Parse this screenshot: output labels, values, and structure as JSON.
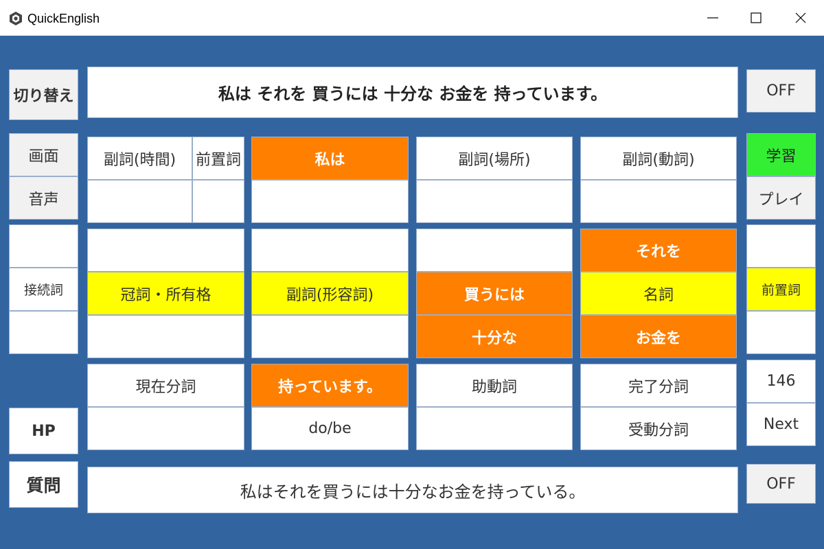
{
  "window": {
    "title": "QuickEnglish"
  },
  "left": {
    "switch": "切り替え",
    "screen": "画面",
    "voice": "音声",
    "conjunction": "接続詞",
    "hp": "HP",
    "question": "質問"
  },
  "right": {
    "off_top": "OFF",
    "study": "学習",
    "play": "プレイ",
    "preposition": "前置詞",
    "count": "146",
    "next": "Next",
    "off_bottom": "OFF"
  },
  "sentence": "私は それを 買うには 十分な お金を 持っています。",
  "translation": "私はそれを買うには十分なお金を持っている。",
  "grid": {
    "adverb_time": "副詞(時間)",
    "preposition": "前置詞",
    "subject": "私は",
    "adverb_place": "副詞(場所)",
    "adverb_verb": "副詞(動詞)",
    "object_top": "それを",
    "article_possessive": "冠詞・所有格",
    "adverb_adjective": "副詞(形容詞)",
    "kau_niwa": "買うには",
    "noun": "名詞",
    "juubun_na": "十分な",
    "okane_wo": "お金を",
    "present_participle": "現在分詞",
    "verb": "持っています。",
    "auxiliary": "助動詞",
    "perfect_participle": "完了分詞",
    "do_be": "do/be",
    "passive_participle": "受動分詞"
  },
  "colors": {
    "background": "#3264a0",
    "orange": "#ff7f00",
    "yellow": "#ffff00",
    "green": "#33ee33"
  }
}
